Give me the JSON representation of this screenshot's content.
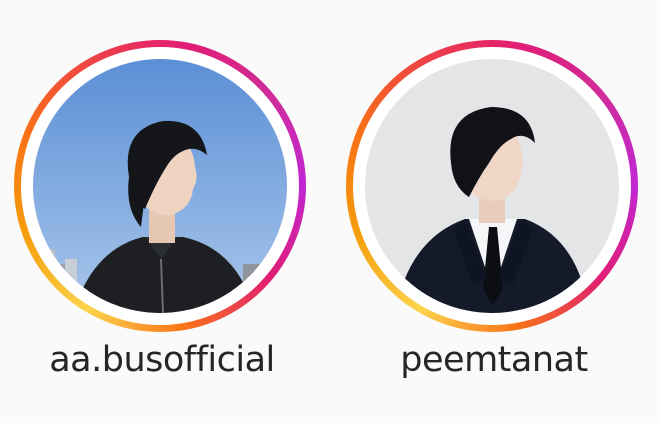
{
  "stories": [
    {
      "username": "aa.busofficial",
      "ring_colors": [
        "#fcd34d",
        "#f97316",
        "#e11d74",
        "#c026d3"
      ]
    },
    {
      "username": "peemtanat",
      "ring_colors": [
        "#fcd34d",
        "#f97316",
        "#e11d74",
        "#c026d3"
      ]
    }
  ]
}
